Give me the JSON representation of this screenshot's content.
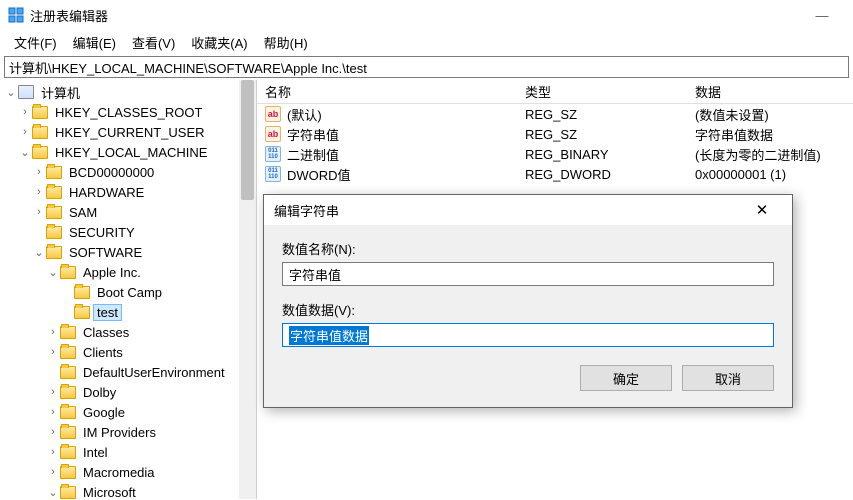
{
  "window": {
    "title": "注册表编辑器",
    "minimize": "—"
  },
  "menu": {
    "file": "文件(F)",
    "edit": "编辑(E)",
    "view": "查看(V)",
    "favorites": "收藏夹(A)",
    "help": "帮助(H)"
  },
  "path": "计算机\\HKEY_LOCAL_MACHINE\\SOFTWARE\\Apple Inc.\\test",
  "tree": {
    "root": "计算机",
    "hkcr": "HKEY_CLASSES_ROOT",
    "hkcu": "HKEY_CURRENT_USER",
    "hklm": "HKEY_LOCAL_MACHINE",
    "bcd": "BCD00000000",
    "hardware": "HARDWARE",
    "sam": "SAM",
    "security": "SECURITY",
    "software": "SOFTWARE",
    "apple": "Apple Inc.",
    "bootcamp": "Boot Camp",
    "test": "test",
    "classes": "Classes",
    "clients": "Clients",
    "default_env": "DefaultUserEnvironment",
    "dolby": "Dolby",
    "google": "Google",
    "improviders": "IM Providers",
    "intel": "Intel",
    "macromedia": "Macromedia",
    "microsoft": "Microsoft"
  },
  "list": {
    "headers": {
      "name": "名称",
      "type": "类型",
      "data": "数据"
    },
    "rows": [
      {
        "icon": "str",
        "name": "(默认)",
        "type": "REG_SZ",
        "data": "(数值未设置)"
      },
      {
        "icon": "str",
        "name": "字符串值",
        "type": "REG_SZ",
        "data": "字符串值数据"
      },
      {
        "icon": "bin",
        "name": "二进制值",
        "type": "REG_BINARY",
        "data": "(长度为零的二进制值)"
      },
      {
        "icon": "bin",
        "name": "DWORD值",
        "type": "REG_DWORD",
        "data": "0x00000001 (1)"
      }
    ]
  },
  "dialog": {
    "title": "编辑字符串",
    "close": "✕",
    "name_label": "数值名称(N):",
    "name_value": "字符串值",
    "data_label": "数值数据(V):",
    "data_value": "字符串值数据",
    "ok": "确定",
    "cancel": "取消"
  },
  "icons": {
    "str": "ab",
    "bin": "011\n110"
  }
}
